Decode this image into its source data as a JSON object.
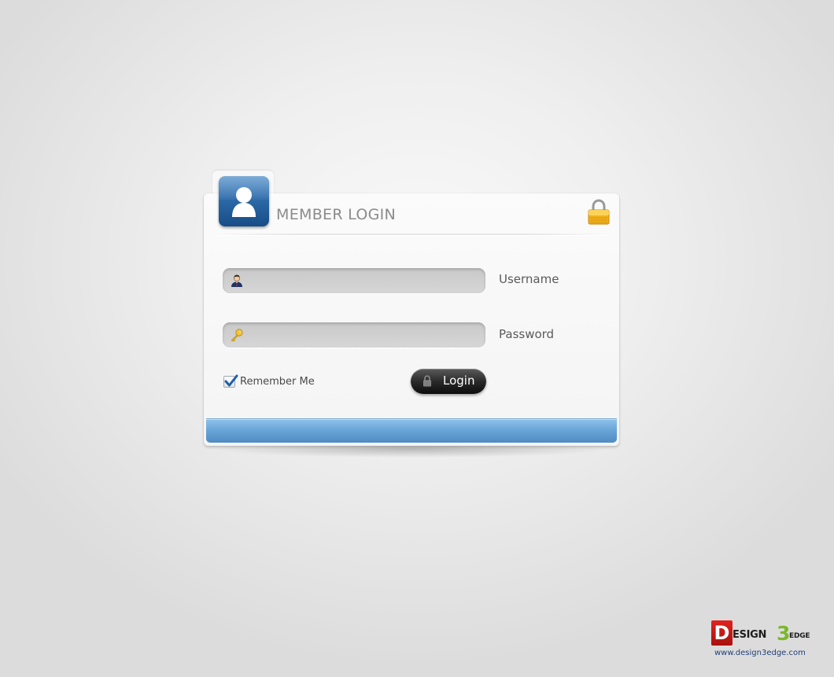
{
  "header": {
    "title": "MEMBER LOGIN",
    "avatar_icon": "user-icon",
    "lock_icon": "padlock-icon"
  },
  "form": {
    "username": {
      "label": "Username",
      "value": "",
      "placeholder": "",
      "icon": "person-icon"
    },
    "password": {
      "label": "Password",
      "value": "",
      "placeholder": "",
      "icon": "key-icon"
    },
    "remember": {
      "label": "Remember Me",
      "checked": true
    },
    "login_button": {
      "label": "Login",
      "icon": "lock-icon"
    }
  },
  "brand": {
    "logo_d": "D",
    "logo_text": "ESIGN",
    "logo_three": "3",
    "logo_edge": "EDGE",
    "url": "www.design3edge.com"
  },
  "colors": {
    "accent_blue": "#4f8bc2",
    "button_dark": "#1a1a1a",
    "brand_red": "#c8191a",
    "brand_green": "#7ab829"
  }
}
